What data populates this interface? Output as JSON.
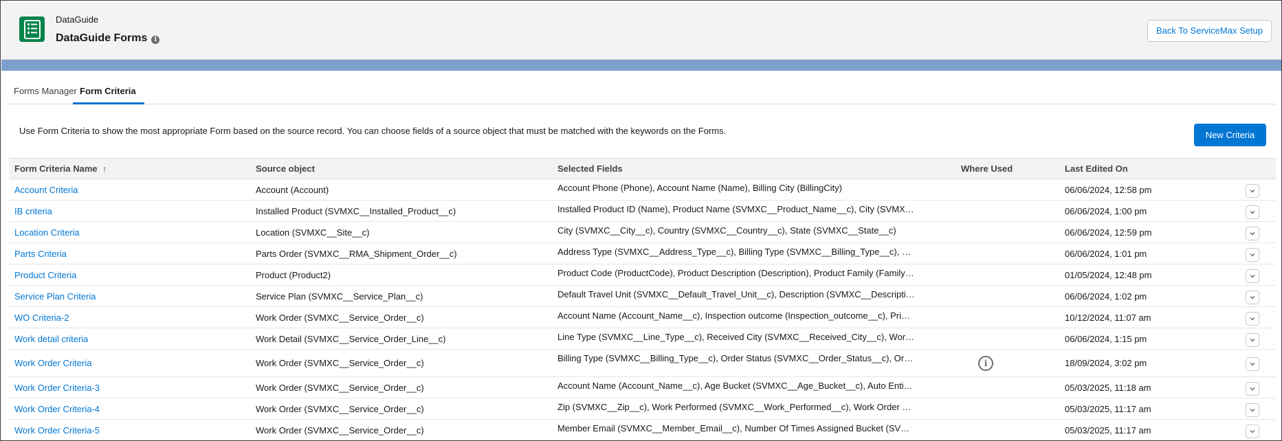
{
  "header": {
    "app_label": "DataGuide",
    "title": "DataGuide Forms",
    "back_button": "Back To ServiceMax Setup"
  },
  "tabs": [
    {
      "label": "Forms Manager",
      "active": false
    },
    {
      "label": "Form Criteria",
      "active": true
    }
  ],
  "description": "Use Form Criteria to show the most appropriate Form based on the source record. You can choose fields of a source object that must be matched with the keywords on the Forms.",
  "new_button": "New Criteria",
  "table": {
    "columns": [
      "Form Criteria Name",
      "Source object",
      "Selected Fields",
      "Where Used",
      "Last Edited On"
    ],
    "sort_indicator": "↑",
    "rows": [
      {
        "name": "Account Criteria",
        "source": "Account (Account)",
        "fields": "Account Phone (Phone), Account Name (Name), Billing City (BillingCity)",
        "where_used": false,
        "edited": "06/06/2024, 12:58 pm"
      },
      {
        "name": "IB criteria",
        "source": "Installed Product (SVMXC__Installed_Product__c)",
        "fields": "Installed Product ID (Name), Product Name (SVMXC__Product_Name__c), City (SVMXC_...",
        "where_used": false,
        "edited": "06/06/2024, 1:00 pm"
      },
      {
        "name": "Location Criteria",
        "source": "Location (SVMXC__Site__c)",
        "fields": "City (SVMXC__City__c), Country (SVMXC__Country__c), State (SVMXC__State__c)",
        "where_used": false,
        "edited": "06/06/2024, 12:59 pm"
      },
      {
        "name": "Parts Criteria",
        "source": "Parts Order (SVMXC__RMA_Shipment_Order__c)",
        "fields": "Address Type (SVMXC__Address_Type__c), Billing Type (SVMXC__Billing_Type__c), Shippi...",
        "where_used": false,
        "edited": "06/06/2024, 1:01 pm"
      },
      {
        "name": "Product Criteria",
        "source": "Product (Product2)",
        "fields": "Product Code (ProductCode), Product Description (Description), Product Family (Family)...",
        "where_used": false,
        "edited": "01/05/2024, 12:48 pm"
      },
      {
        "name": "Service Plan Criteria",
        "source": "Service Plan (SVMXC__Service_Plan__c)",
        "fields": "Default Travel Unit (SVMXC__Default_Travel_Unit__c), Description (SVMXC__Description_...",
        "where_used": false,
        "edited": "06/06/2024, 1:02 pm"
      },
      {
        "name": "WO Criteria-2",
        "source": "Work Order (SVMXC__Service_Order__c)",
        "fields": "Account Name (Account_Name__c), Inspection outcome (Inspection_outcome__c), Priori...",
        "where_used": false,
        "edited": "10/12/2024, 11:07 am"
      },
      {
        "name": "Work detail criteria",
        "source": "Work Detail (SVMXC__Service_Order_Line__c)",
        "fields": "Line Type (SVMXC__Line_Type__c), Received City (SVMXC__Received_City__c), Work Desc...",
        "where_used": false,
        "edited": "06/06/2024, 1:15 pm"
      },
      {
        "name": "Work Order Criteria",
        "source": "Work Order (SVMXC__Service_Order__c)",
        "fields": "Billing Type (SVMXC__Billing_Type__c), Order Status (SVMXC__Order_Status__c), Order T...",
        "where_used": true,
        "edited": "18/09/2024, 3:02 pm"
      },
      {
        "name": "Work Order Criteria-3",
        "source": "Work Order (SVMXC__Service_Order__c)",
        "fields": "Account Name (Account_Name__c), Age Bucket (SVMXC__Age_Bucket__c), Auto Entitle...",
        "where_used": false,
        "edited": "05/03/2025, 11:18 am"
      },
      {
        "name": "Work Order Criteria-4",
        "source": "Work Order (SVMXC__Service_Order__c)",
        "fields": "Zip (SVMXC__Zip__c), Work Performed (SVMXC__Work_Performed__c), Work Order Num...",
        "where_used": false,
        "edited": "05/03/2025, 11:17 am"
      },
      {
        "name": "Work Order Criteria-5",
        "source": "Work Order (SVMXC__Service_Order__c)",
        "fields": "Member Email (SVMXC__Member_Email__c), Number Of Times Assigned Bucket (SVMX...",
        "where_used": false,
        "edited": "05/03/2025, 11:17 am"
      }
    ]
  },
  "icons": {
    "app": "form-list-icon",
    "info": "info-icon",
    "row_action": "chevron-down-icon",
    "where_used": "info-circle-icon"
  },
  "colors": {
    "accent": "#0176d3",
    "app_icon": "#04844b",
    "band": "#7d9fcc"
  }
}
